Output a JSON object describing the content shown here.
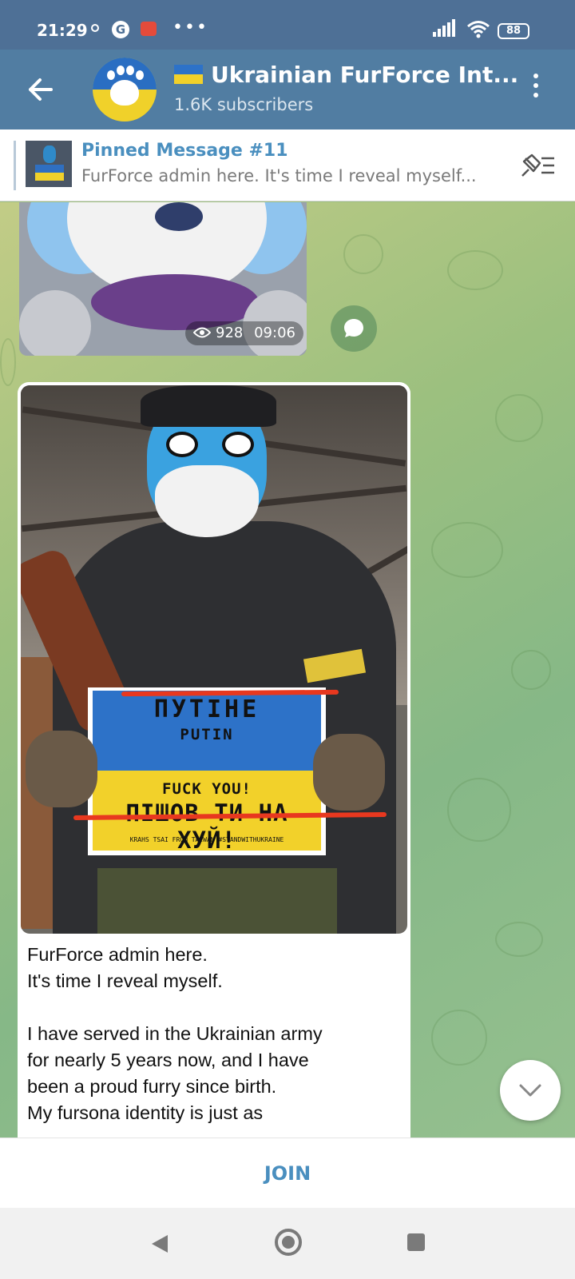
{
  "status_bar": {
    "time": "21:29",
    "battery": "88",
    "google_icon": "G",
    "more": "•••"
  },
  "header": {
    "title": "Ukrainian FurForce Int...",
    "subscribers": "1.6K subscribers"
  },
  "pinned": {
    "title": "Pinned Message #11",
    "text": "FurForce admin here. It's time I reveal myself..."
  },
  "media_post": {
    "views": "928",
    "time": "09:06"
  },
  "photo_sign": {
    "line1": "ПУТІНЕ",
    "line2": "PUTIN",
    "line3": "FUCK YOU!",
    "line4": "ПІШОВ ТИ НА ХУЙ!",
    "credit": "KRAHS TSAI FROM TAIWAN  #STANDWITHUKRAINE"
  },
  "post": {
    "lines": [
      "FurForce admin here.",
      "It's time I reveal myself.",
      "",
      "I have served in the Ukrainian army",
      "for nearly 5 years now, and I have",
      "been a proud furry since birth.",
      "My fursona identity is just as"
    ]
  },
  "join": {
    "label": "JOIN"
  },
  "colors": {
    "app_bar": "#517da2",
    "status_bar": "#4e7096",
    "accent": "#4a8fbf",
    "flag_blue": "#2d72c8",
    "flag_yellow": "#f2d12a"
  },
  "icons": [
    "back-arrow-icon",
    "menu-dots-icon",
    "pin-list-icon",
    "eye-icon",
    "comment-icon",
    "chevron-down-icon",
    "signal-icon",
    "wifi-icon"
  ]
}
